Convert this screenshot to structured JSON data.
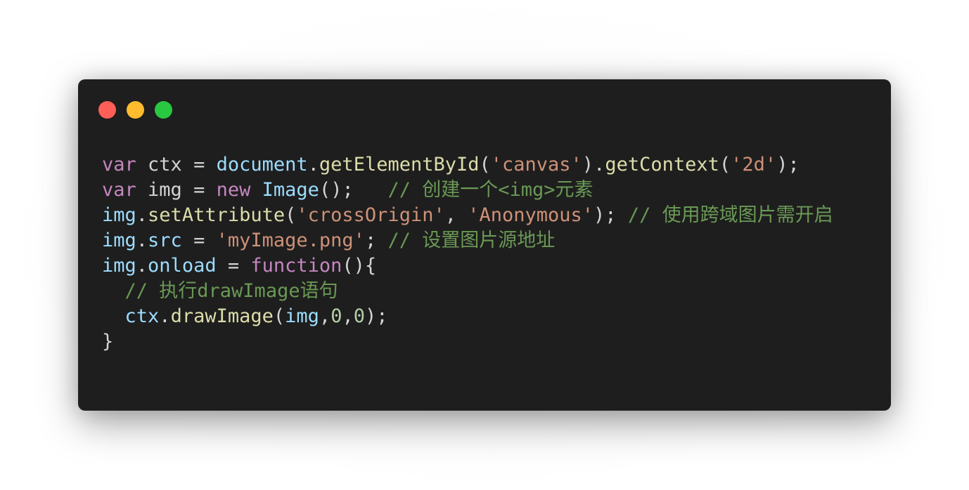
{
  "window": {
    "buttons": [
      "close",
      "minimize",
      "maximize"
    ]
  },
  "code": {
    "line1": {
      "kw": "var",
      "name": "ctx",
      "eq": " = ",
      "obj": "document",
      "dot1": ".",
      "fn1": "getElementById",
      "p1": "(",
      "s1": "'canvas'",
      "p2": ").",
      "fn2": "getContext",
      "p3": "(",
      "s2": "'2d'",
      "p4": ");"
    },
    "line2": {
      "kw": "var",
      "name": "img",
      "eq": " = ",
      "kw2": "new",
      "cls": "Image",
      "p1": "();",
      "pad": "   ",
      "comment": "// 创建一个<img>元素"
    },
    "line3": {
      "obj": "img",
      "dot": ".",
      "fn": "setAttribute",
      "p1": "(",
      "s1": "'crossOrigin'",
      "comma": ", ",
      "s2": "'Anonymous'",
      "p2": "); ",
      "comment": "// 使用跨域图片需开启"
    },
    "line4": {
      "obj": "img",
      "dot": ".",
      "prop": "src",
      "eq": " = ",
      "s1": "'myImage.png'",
      "p1": "; ",
      "comment": "// 设置图片源地址"
    },
    "line5": {
      "obj": "img",
      "dot": ".",
      "prop": "onload",
      "eq": " = ",
      "kw": "function",
      "p1": "(){"
    },
    "line6": {
      "indent": "  ",
      "comment": "// 执行drawImage语句"
    },
    "line7": {
      "indent": "  ",
      "obj": "ctx",
      "dot": ".",
      "fn": "drawImage",
      "p1": "(",
      "arg1": "img",
      "c1": ",",
      "n1": "0",
      "c2": ",",
      "n2": "0",
      "p2": ");"
    },
    "line8": {
      "p1": "}"
    }
  }
}
